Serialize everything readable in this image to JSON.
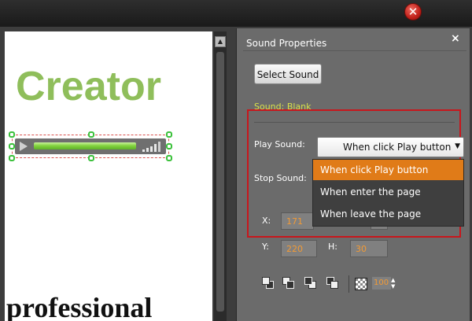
{
  "window": {
    "close_glyph": "✕"
  },
  "canvas": {
    "title_text": "Creator",
    "bottom_text": "professional"
  },
  "panel": {
    "title": "Sound Properties",
    "close_glyph": "×",
    "select_sound_label": "Select Sound",
    "sound_status": "Sound: Blank",
    "play_sound_label": "Play Sound:",
    "play_sound_value": "When click Play button",
    "stop_sound_label": "Stop Sound:",
    "dropdown_options": [
      "When click Play button",
      "When enter the page",
      "When leave the page"
    ],
    "selected_option_index": 0,
    "x_label": "X:",
    "x_value": "171",
    "y_label": "Y:",
    "y_value": "220",
    "h_label": "H:",
    "h_value": "30",
    "opacity_value": "100"
  },
  "colors": {
    "accent_orange": "#e07b18",
    "highlight_red": "#c8161c",
    "creator_green": "#8fbe5b",
    "status_yellow": "#d8e04a"
  },
  "icons": {
    "window_close": "close-icon",
    "panel_close": "close-icon",
    "play": "play-icon",
    "volume": "volume-icon",
    "dropdown": "chevron-down-icon",
    "layer_tools": [
      "bring-to-front-icon",
      "send-to-back-icon",
      "bring-forward-icon",
      "send-backward-icon"
    ],
    "transparency": "transparency-icon"
  }
}
